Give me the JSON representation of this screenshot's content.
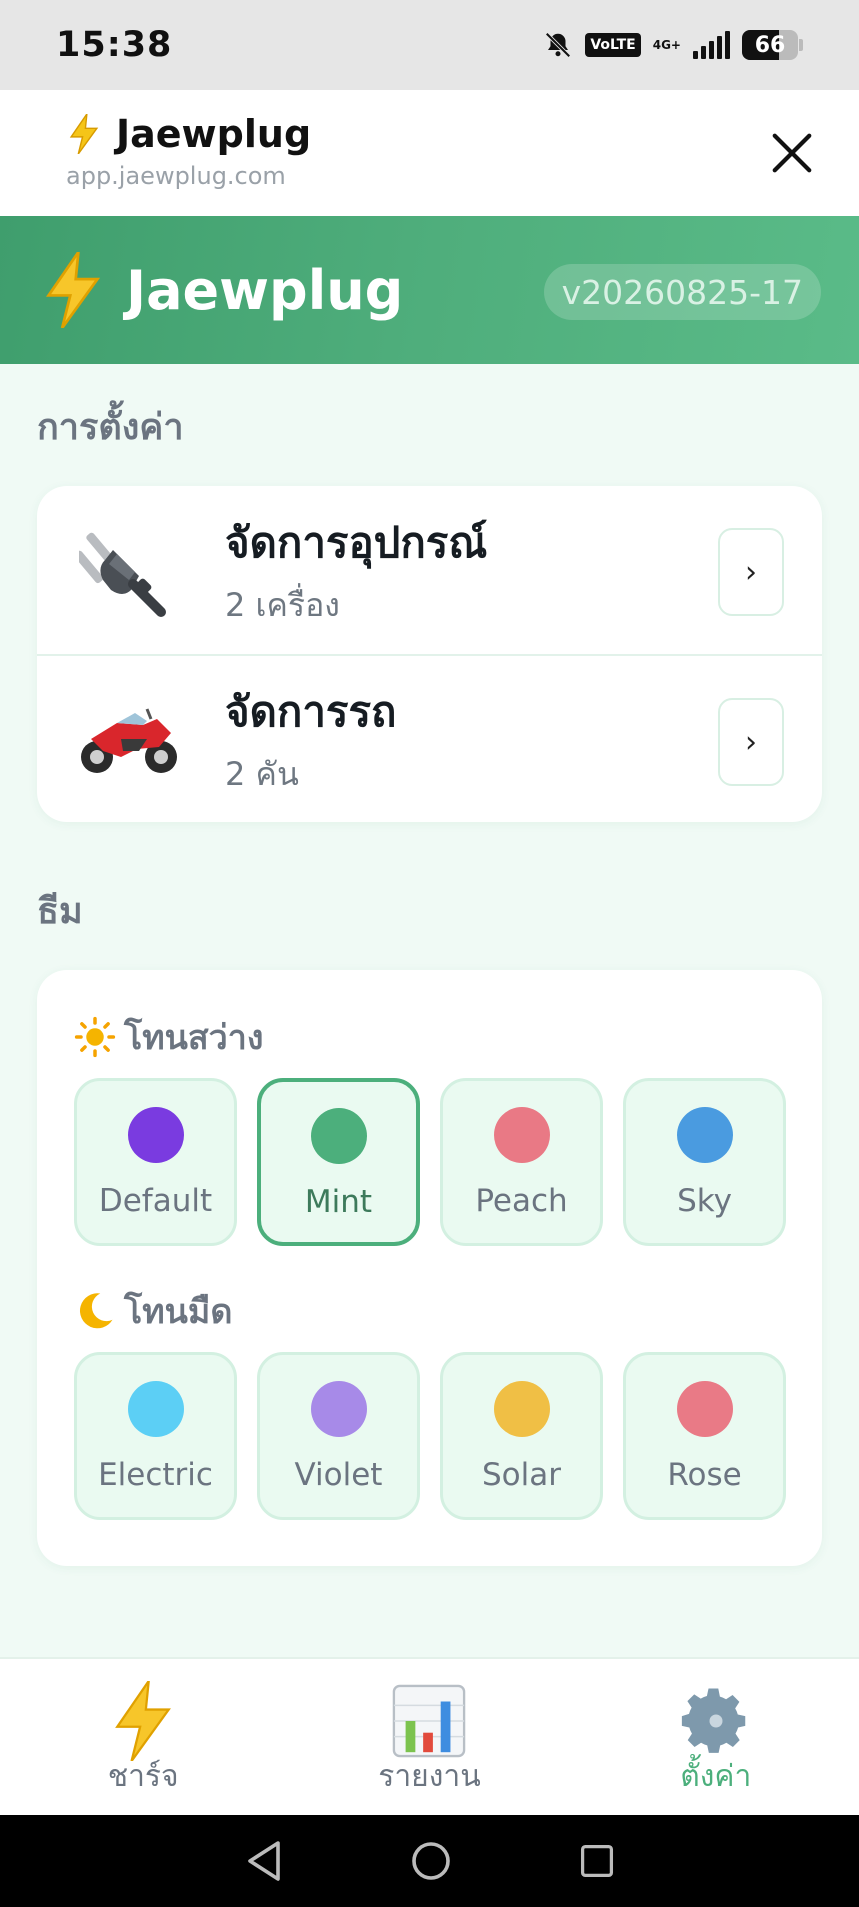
{
  "status_bar": {
    "time": "15:38",
    "volte": "VoLTE",
    "network": "4G+",
    "battery": "66",
    "battery_level": 0.66
  },
  "browser": {
    "title": "Jaewplug",
    "url": "app.jaewplug.com"
  },
  "header": {
    "title": "Jaewplug",
    "version": "v20260825-17"
  },
  "settings": {
    "title": "การตั้งค่า",
    "items": [
      {
        "label": "จัดการอุปกรณ์",
        "sub": "2 เครื่อง",
        "icon": "plug-icon",
        "action": "›"
      },
      {
        "label": "จัดการรถ",
        "sub": "2 คัน",
        "icon": "motorcycle-icon",
        "action": "›"
      }
    ]
  },
  "theme": {
    "title": "ธีม",
    "light_title": "โทนสว่าง",
    "dark_title": "โทนมืด",
    "light": [
      {
        "label": "Default",
        "color": "#7a3be0"
      },
      {
        "label": "Mint",
        "color": "#4caf7c"
      },
      {
        "label": "Peach",
        "color": "#e97985"
      },
      {
        "label": "Sky",
        "color": "#4a9be0"
      }
    ],
    "dark": [
      {
        "label": "Electric",
        "color": "#5ccff5"
      },
      {
        "label": "Violet",
        "color": "#a78ae8"
      },
      {
        "label": "Solar",
        "color": "#f0bf45"
      },
      {
        "label": "Rose",
        "color": "#e97a86"
      }
    ],
    "selected": "Mint"
  },
  "nav": {
    "items": [
      {
        "label": "ชาร์จ",
        "icon": "lightning-icon"
      },
      {
        "label": "รายงาน",
        "icon": "bar-chart-icon"
      },
      {
        "label": "ตั้งค่า",
        "icon": "gear-icon",
        "active": true
      }
    ]
  },
  "colors": {
    "primary": "#4caf7c",
    "header_gradient_start": "#3f9e6d",
    "header_gradient_end": "#5abb88"
  }
}
